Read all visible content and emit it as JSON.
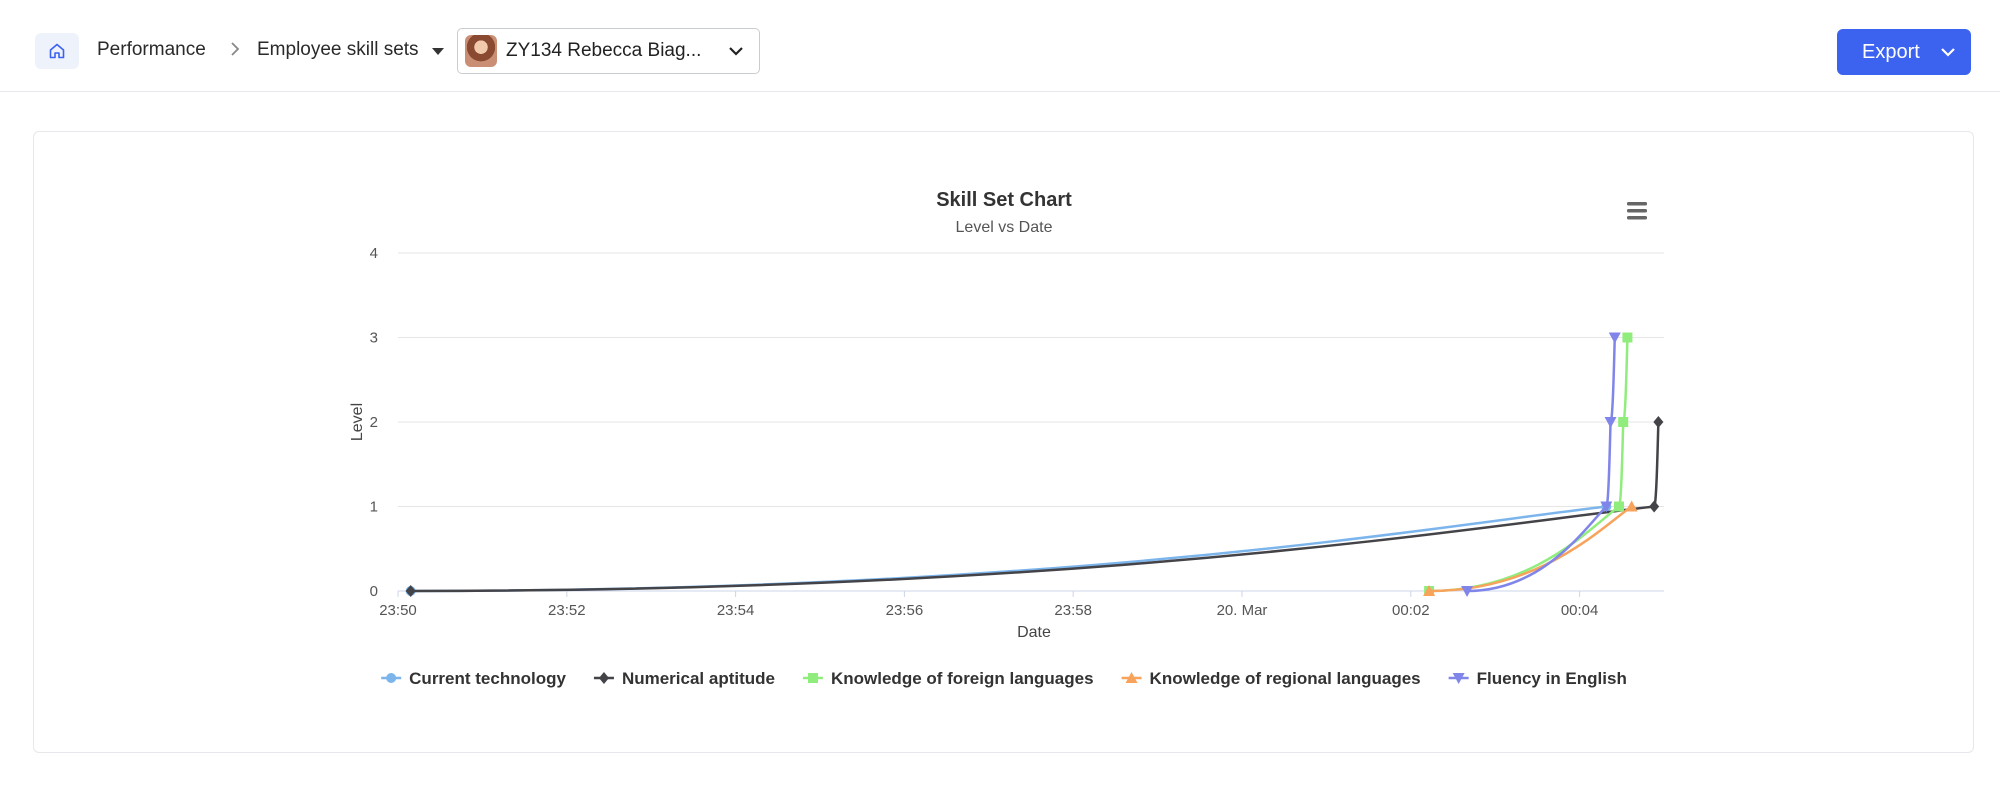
{
  "breadcrumb": {
    "home_icon": "home-icon",
    "item1": "Performance",
    "separator_icon": "chevron-right-icon",
    "item2": "Employee skill sets",
    "dropdown_icon": "caret-down-icon"
  },
  "employee_select": {
    "value": "ZY134 Rebecca Biag...",
    "icon": "chevron-down-icon"
  },
  "export_button": {
    "label": "Export",
    "icon": "chevron-down-icon",
    "color": "#3c62f0"
  },
  "chart_menu_icon": "hamburger-menu-icon",
  "chart_data": {
    "type": "line",
    "title": "Skill Set Chart",
    "subtitle": "Level vs Date",
    "xlabel": "Date",
    "ylabel": "Level",
    "ylim": [
      0,
      4
    ],
    "yticks": [
      0,
      1,
      2,
      3,
      4
    ],
    "xlim": [
      "23:50",
      "00:05"
    ],
    "xticks": [
      "23:50",
      "23:52",
      "23:54",
      "23:56",
      "23:58",
      "20. Mar",
      "00:02",
      "00:04"
    ],
    "grid": true,
    "legend_position": "bottom",
    "series": [
      {
        "name": "Current technology",
        "color": "#7cb5ec",
        "marker": "circle",
        "points": [
          [
            "23:50:09",
            0
          ],
          [
            "00:04:19",
            1
          ]
        ]
      },
      {
        "name": "Numerical aptitude",
        "color": "#434348",
        "marker": "diamond",
        "points": [
          [
            "23:50:09",
            0
          ],
          [
            "00:04:53",
            1
          ],
          [
            "00:04:56",
            2
          ]
        ]
      },
      {
        "name": "Knowledge of foreign languages",
        "color": "#90ed7d",
        "marker": "square",
        "points": [
          [
            "00:02:13",
            0
          ],
          [
            "00:04:28",
            1
          ],
          [
            "00:04:31",
            2
          ],
          [
            "00:04:34",
            3
          ]
        ]
      },
      {
        "name": "Knowledge of regional languages",
        "color": "#f7a35c",
        "marker": "triangle",
        "points": [
          [
            "00:02:13",
            0
          ],
          [
            "00:04:37",
            1
          ]
        ]
      },
      {
        "name": "Fluency in English",
        "color": "#8085e9",
        "marker": "triangle-down",
        "points": [
          [
            "00:02:40",
            0
          ],
          [
            "00:04:19",
            1
          ],
          [
            "00:04:22",
            2
          ],
          [
            "00:04:25",
            3
          ]
        ]
      }
    ]
  }
}
